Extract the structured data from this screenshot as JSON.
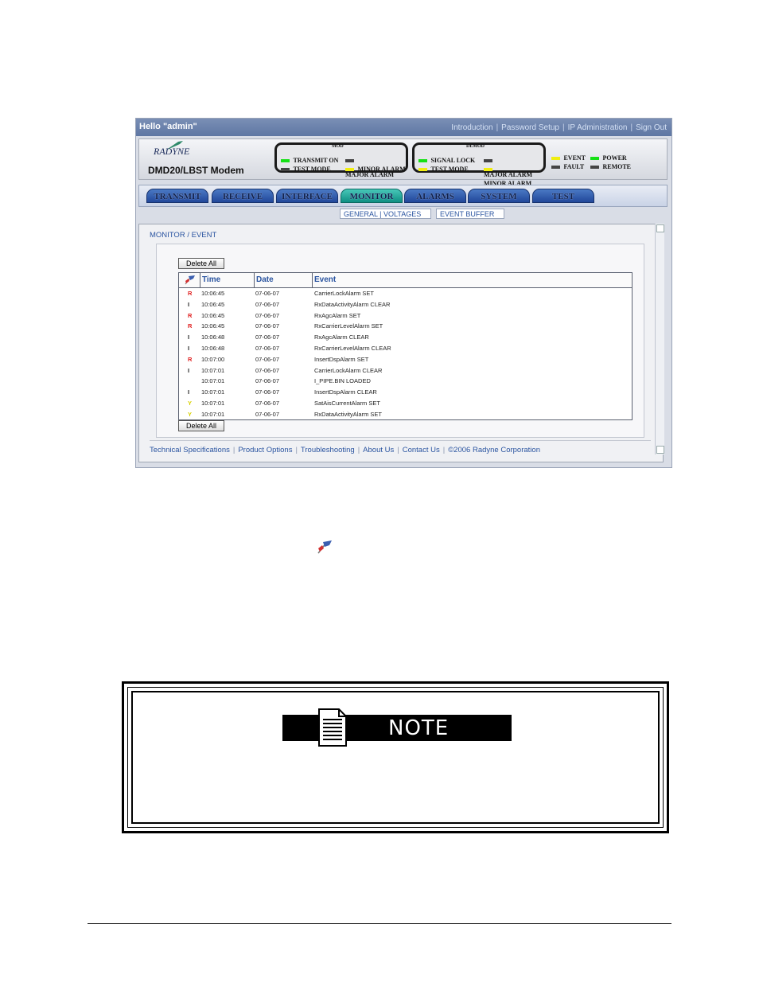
{
  "topbar": {
    "greeting": "Hello \"admin\"",
    "links": [
      "Introduction",
      "Password Setup",
      "IP Administration",
      "Sign Out"
    ]
  },
  "header": {
    "logo_text": "RADYNE",
    "model": "DMD20/LBST Modem",
    "mod": {
      "title": "MOD",
      "leds": [
        {
          "label": "TRANSMIT ON",
          "color": "#16e016"
        },
        {
          "label": "MAJOR ALARM",
          "color": "#444444"
        },
        {
          "label": "TEST MODE",
          "color": "#444444"
        },
        {
          "label": "MINOR ALARM",
          "color": "#f0ee10"
        }
      ]
    },
    "demod": {
      "title": "DEMOD",
      "leds": [
        {
          "label": "SIGNAL LOCK",
          "color": "#16e016"
        },
        {
          "label": "MAJOR ALARM",
          "color": "#444444"
        },
        {
          "label": "TEST MODE",
          "color": "#f0ee10"
        },
        {
          "label": "MINOR ALARM",
          "color": "#f0ee10"
        }
      ]
    },
    "status": [
      {
        "label": "EVENT",
        "color": "#f0ee10"
      },
      {
        "label": "POWER",
        "color": "#16e016"
      },
      {
        "label": "FAULT",
        "color": "#444444"
      },
      {
        "label": "REMOTE",
        "color": "#444444"
      }
    ]
  },
  "tabs": [
    "TRANSMIT",
    "RECEIVE",
    "INTERFACE",
    "MONITOR",
    "ALARMS",
    "SYSTEM",
    "TEST"
  ],
  "active_tab": "MONITOR",
  "subtabs": {
    "general_voltages": "GENERAL | VOLTAGES",
    "event_buffer": "EVENT BUFFER"
  },
  "breadcrumb": "MONITOR / EVENT",
  "buttons": {
    "delete_all_top": "Delete All",
    "delete_all_bottom": "Delete All"
  },
  "table": {
    "headers": {
      "time": "Time",
      "date": "Date",
      "event": "Event"
    },
    "rows": [
      {
        "type": "R",
        "time": "10:06:45",
        "date": "07-06-07",
        "event": "CarrierLockAlarm SET"
      },
      {
        "type": "I",
        "time": "10:06:45",
        "date": "07-06-07",
        "event": "RxDataActivityAlarm CLEAR"
      },
      {
        "type": "R",
        "time": "10:06:45",
        "date": "07-06-07",
        "event": "RxAgcAlarm SET"
      },
      {
        "type": "R",
        "time": "10:06:45",
        "date": "07-06-07",
        "event": "RxCarrierLevelAlarm SET"
      },
      {
        "type": "I",
        "time": "10:06:48",
        "date": "07-06-07",
        "event": "RxAgcAlarm CLEAR"
      },
      {
        "type": "I",
        "time": "10:06:48",
        "date": "07-06-07",
        "event": "RxCarrierLevelAlarm CLEAR"
      },
      {
        "type": "R",
        "time": "10:07:00",
        "date": "07-06-07",
        "event": "InsertDspAlarm SET"
      },
      {
        "type": "I",
        "time": "10:07:01",
        "date": "07-06-07",
        "event": "CarrierLockAlarm CLEAR"
      },
      {
        "type": "",
        "time": "10:07:01",
        "date": "07-06-07",
        "event": "I_PIPE.BIN LOADED"
      },
      {
        "type": "I",
        "time": "10:07:01",
        "date": "07-06-07",
        "event": "InsertDspAlarm CLEAR"
      },
      {
        "type": "Y",
        "time": "10:07:01",
        "date": "07-06-07",
        "event": "SatAisCurrentAlarm SET"
      },
      {
        "type": "Y",
        "time": "10:07:01",
        "date": "07-06-07",
        "event": "RxDataActivityAlarm SET"
      }
    ],
    "type_colors": {
      "R": "#e02020",
      "I": "#222222",
      "Y": "#d8d000"
    }
  },
  "footer": {
    "links": [
      "Technical Specifications",
      "Product Options",
      "Troubleshooting",
      "About Us",
      "Contact Us"
    ],
    "copyright": "©2006 Radyne Corporation"
  },
  "note": {
    "title": "NOTE"
  }
}
